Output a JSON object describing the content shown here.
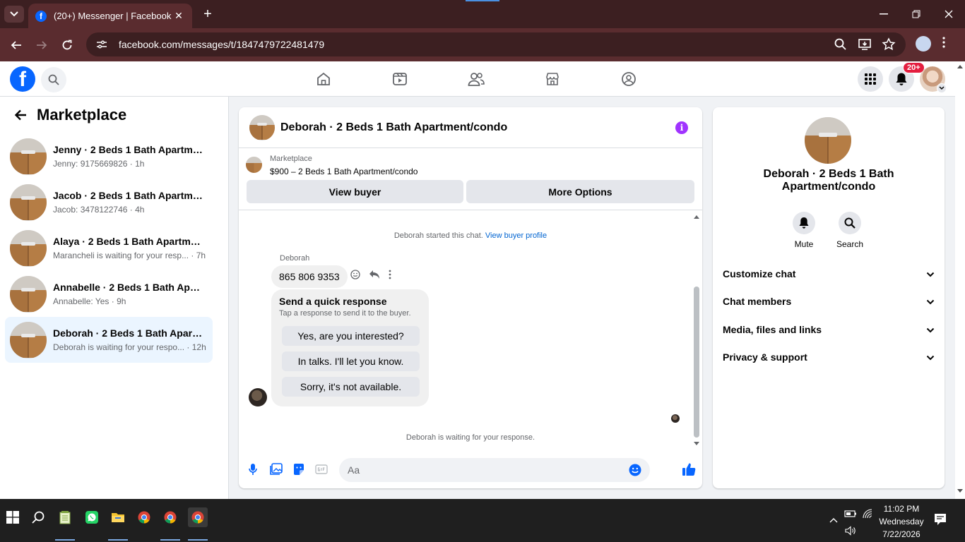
{
  "browser": {
    "tab_title": "(20+) Messenger | Facebook",
    "url": "facebook.com/messages/t/1847479722481479"
  },
  "fb": {
    "notifications_badge": "20+"
  },
  "sidebar": {
    "title": "Marketplace",
    "conversations": [
      {
        "name": "Jenny · 2 Beds 1 Bath Apartment...",
        "preview": "Jenny: 9175669826 · 1h",
        "active": false
      },
      {
        "name": "Jacob · 2 Beds 1 Bath Apartment...",
        "preview": "Jacob: 3478122746 · 4h",
        "active": false
      },
      {
        "name": "Alaya · 2 Beds 1 Bath Apartment...",
        "preview": "Marancheli is waiting for your resp... · 7h",
        "active": false
      },
      {
        "name": "Annabelle · 2 Beds 1 Bath Apart...",
        "preview": "Annabelle: Yes · 9h",
        "active": false
      },
      {
        "name": "Deborah · 2 Beds 1 Bath Apartm...",
        "preview": "Deborah is waiting for your respo... · 12h",
        "active": true
      }
    ]
  },
  "chat": {
    "title": "Deborah · 2 Beds 1 Bath Apartment/condo",
    "marketplace_label": "Marketplace",
    "listing": "$900 – 2 Beds 1 Bath Apartment/condo",
    "view_buyer_label": "View buyer",
    "more_options_label": "More Options",
    "started_text": "Deborah started this chat.",
    "view_profile_link": "View buyer profile",
    "sender_name": "Deborah",
    "message": "865 806 9353",
    "quick_title": "Send a quick response",
    "quick_subtitle": "Tap a response to send it to the buyer.",
    "quick_options": [
      "Yes, are you interested?",
      "In talks. I'll let you know.",
      "Sorry, it's not available."
    ],
    "waiting_text": "Deborah is waiting for your response.",
    "composer_placeholder": "Aa"
  },
  "info_panel": {
    "name": "Deborah · 2 Beds 1 Bath Apartment/condo",
    "mute_label": "Mute",
    "search_label": "Search",
    "sections": [
      "Customize chat",
      "Chat members",
      "Media, files and links",
      "Privacy & support"
    ]
  },
  "taskbar": {
    "time": "11:02 PM",
    "day": "Wednesday",
    "date": "7/22/2026"
  },
  "colors": {
    "fb_blue": "#0866ff",
    "chrome_frame": "#3c1f21",
    "info_purple": "#a033ff",
    "badge_red": "#e41e3f"
  }
}
